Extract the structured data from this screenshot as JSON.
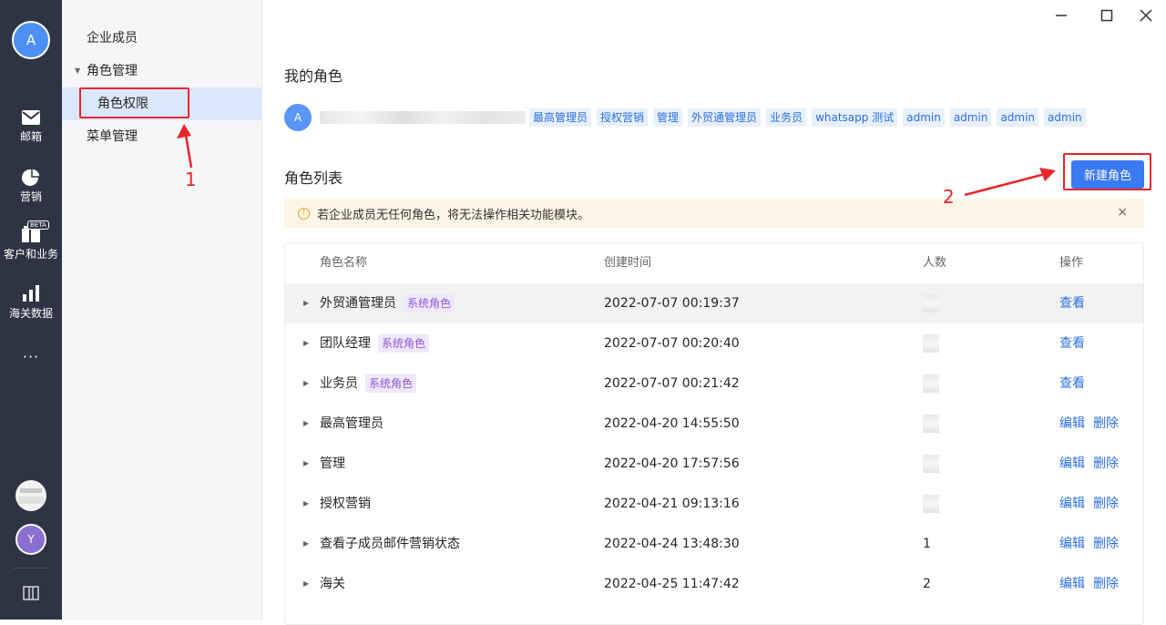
{
  "rail": {
    "avatar": "A",
    "items": [
      {
        "label": "邮箱",
        "icon": "mail-icon"
      },
      {
        "label": "营销",
        "icon": "pie-chart-icon"
      },
      {
        "label": "客户和业务",
        "icon": "customer-icon",
        "badge": "BETA"
      },
      {
        "label": "海关数据",
        "icon": "bar-chart-icon"
      }
    ],
    "more": "···",
    "user_avatar": "Y"
  },
  "subnav": {
    "members": "企业成员",
    "role_group": "角色管理",
    "role_permission": "角色权限",
    "menu_manage": "菜单管理"
  },
  "annotations": {
    "one": "1",
    "two": "2"
  },
  "main": {
    "my_role_title": "我的角色",
    "my_avatar": "A",
    "my_tags": [
      "最高管理员",
      "授权营销",
      "管理",
      "外贸通管理员",
      "业务员",
      "whatsapp 测试",
      "admin",
      "admin",
      "admin",
      "admin"
    ],
    "role_list_title": "角色列表",
    "new_role_button": "新建角色",
    "notice": "若企业成员无任何角色，将无法操作相关功能模块。",
    "table": {
      "headers": {
        "name": "角色名称",
        "time": "创建时间",
        "count": "人数",
        "op": "操作"
      },
      "rows": [
        {
          "name": "外贸通管理员",
          "tag": "系统角色",
          "time": "2022-07-07 00:19:37",
          "count": "",
          "ops": [
            "查看"
          ]
        },
        {
          "name": "团队经理",
          "tag": "系统角色",
          "time": "2022-07-07 00:20:40",
          "count": "",
          "ops": [
            "查看"
          ]
        },
        {
          "name": "业务员",
          "tag": "系统角色",
          "time": "2022-07-07 00:21:42",
          "count": "",
          "ops": [
            "查看"
          ]
        },
        {
          "name": "最高管理员",
          "tag": "",
          "time": "2022-04-20 14:55:50",
          "count": "",
          "ops": [
            "编辑",
            "删除"
          ]
        },
        {
          "name": "管理",
          "tag": "",
          "time": "2022-04-20 17:57:56",
          "count": "",
          "ops": [
            "编辑",
            "删除"
          ]
        },
        {
          "name": "授权营销",
          "tag": "",
          "time": "2022-04-21 09:13:16",
          "count": "",
          "ops": [
            "编辑",
            "删除"
          ]
        },
        {
          "name": "查看子成员邮件营销状态",
          "tag": "",
          "time": "2022-04-24 13:48:30",
          "count": "1",
          "ops": [
            "编辑",
            "删除"
          ]
        },
        {
          "name": "海关",
          "tag": "",
          "time": "2022-04-25 11:47:42",
          "count": "2",
          "ops": [
            "编辑",
            "删除"
          ]
        }
      ]
    }
  }
}
